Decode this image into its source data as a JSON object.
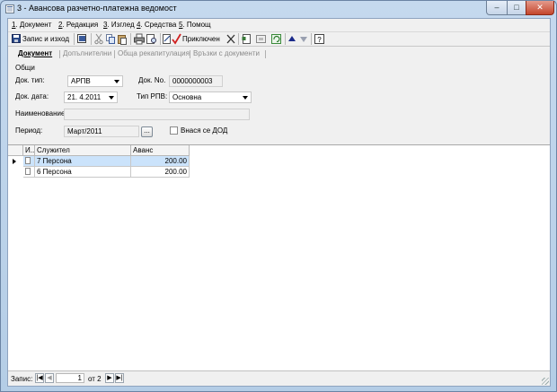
{
  "window": {
    "title": "3 - Авансова разчетно-платежна ведомост",
    "controls": {
      "minimize": "–",
      "maximize": "□",
      "close": "✕"
    }
  },
  "menu": {
    "items": [
      {
        "hotkey": "1",
        "label": ". Документ"
      },
      {
        "hotkey": "2",
        "label": ". Редакция"
      },
      {
        "hotkey": "3",
        "label": ". Изглед"
      },
      {
        "hotkey": "4",
        "label": ". Средства"
      },
      {
        "hotkey": "5",
        "label": ". Помощ"
      }
    ]
  },
  "toolbar": {
    "save_close_label": "Запис и изход",
    "completed_label": "Приключен",
    "icons": [
      "save-icon",
      "save-copy-icon",
      "cut-icon",
      "copy-icon",
      "paste-icon",
      "print-icon",
      "print-preview-icon",
      "edit-icon",
      "checkmark-icon",
      "cancel-x-icon",
      "document-icon",
      "document-2-icon",
      "refresh-icon",
      "arrow-up-icon",
      "arrow-down-icon",
      "help-icon"
    ]
  },
  "tabs": [
    {
      "label": "Документ",
      "active": true
    },
    {
      "label": "Допълнителни",
      "active": false
    },
    {
      "label": "Обща рекапитулация",
      "active": false
    },
    {
      "label": "Връзки с документи",
      "active": false
    }
  ],
  "form": {
    "group_title": "Общи",
    "doc_type_label": "Док. тип:",
    "doc_type_value": "АРПВ",
    "doc_no_label": "Док. No.",
    "doc_no_value": "0000000003",
    "doc_date_label": "Док. дата:",
    "doc_date_value": "21.  4.2011",
    "rpv_type_label": "Тип РПВ:",
    "rpv_type_value": "Основна",
    "name_label": "Наименование",
    "name_value": "",
    "period_label": "Период:",
    "period_value": "Март/2011",
    "period_button": "...",
    "dod_label": "Внася се ДОД"
  },
  "grid": {
    "columns": [
      "И...",
      "Служител",
      "Аванс"
    ],
    "rows": [
      {
        "employee": "7 Персона",
        "advance": "200.00",
        "selected": true
      },
      {
        "employee": "6 Персона",
        "advance": "200.00",
        "selected": false
      }
    ]
  },
  "status": {
    "record_label": "Запис:",
    "current": "1",
    "of_label": "от 2",
    "nav": {
      "first": "|◀",
      "prev": "◀",
      "next": "▶",
      "last": "▶|"
    }
  }
}
